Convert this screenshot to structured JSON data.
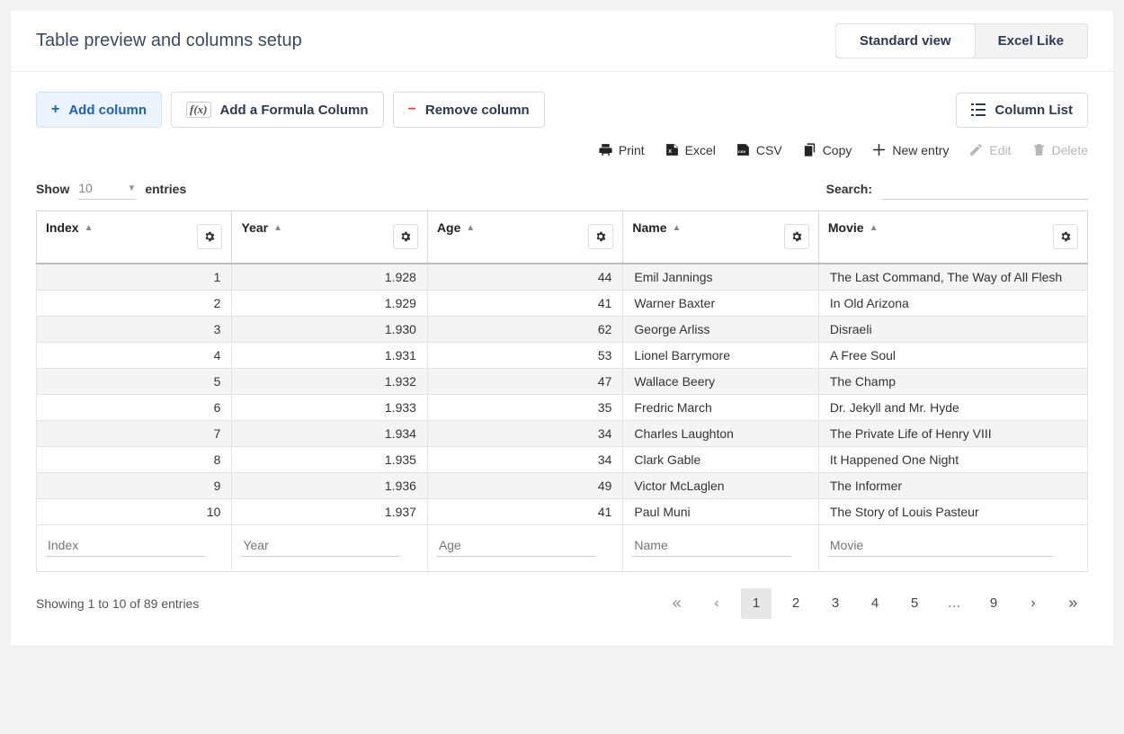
{
  "header": {
    "title": "Table preview and columns setup",
    "view_standard": "Standard view",
    "view_excel": "Excel Like"
  },
  "toolbar": {
    "add_column": "Add column",
    "add_formula": "Add a Formula Column",
    "remove_column": "Remove column",
    "column_list": "Column List"
  },
  "actions": {
    "print": "Print",
    "excel": "Excel",
    "csv": "CSV",
    "copy": "Copy",
    "new_entry": "New entry",
    "edit": "Edit",
    "delete": "Delete"
  },
  "controls": {
    "show_label": "Show",
    "entries_label": "entries",
    "entries_value": "10",
    "search_label": "Search:"
  },
  "columns": [
    {
      "label": "Index",
      "filter_placeholder": "Index",
      "numeric": true
    },
    {
      "label": "Year",
      "filter_placeholder": "Year",
      "numeric": true
    },
    {
      "label": "Age",
      "filter_placeholder": "Age",
      "numeric": true
    },
    {
      "label": "Name",
      "filter_placeholder": "Name",
      "numeric": false
    },
    {
      "label": "Movie",
      "filter_placeholder": "Movie",
      "numeric": false
    }
  ],
  "rows": [
    {
      "c0": "1",
      "c1": "1.928",
      "c2": "44",
      "c3": "Emil Jannings",
      "c4": "The Last Command, The Way of All Flesh"
    },
    {
      "c0": "2",
      "c1": "1.929",
      "c2": "41",
      "c3": "Warner Baxter",
      "c4": "In Old Arizona"
    },
    {
      "c0": "3",
      "c1": "1.930",
      "c2": "62",
      "c3": "George Arliss",
      "c4": "Disraeli"
    },
    {
      "c0": "4",
      "c1": "1.931",
      "c2": "53",
      "c3": "Lionel Barrymore",
      "c4": "A Free Soul"
    },
    {
      "c0": "5",
      "c1": "1.932",
      "c2": "47",
      "c3": "Wallace Beery",
      "c4": "The Champ"
    },
    {
      "c0": "6",
      "c1": "1.933",
      "c2": "35",
      "c3": "Fredric March",
      "c4": "Dr. Jekyll and Mr. Hyde"
    },
    {
      "c0": "7",
      "c1": "1.934",
      "c2": "34",
      "c3": "Charles Laughton",
      "c4": "The Private Life of Henry VIII"
    },
    {
      "c0": "8",
      "c1": "1.935",
      "c2": "34",
      "c3": "Clark Gable",
      "c4": "It Happened One Night"
    },
    {
      "c0": "9",
      "c1": "1.936",
      "c2": "49",
      "c3": "Victor McLaglen",
      "c4": "The Informer"
    },
    {
      "c0": "10",
      "c1": "1.937",
      "c2": "41",
      "c3": "Paul Muni",
      "c4": "The Story of Louis Pasteur"
    }
  ],
  "pager": {
    "info": "Showing 1 to 10 of 89 entries",
    "pages": [
      "1",
      "2",
      "3",
      "4",
      "5",
      "…",
      "9"
    ],
    "active": "1"
  }
}
